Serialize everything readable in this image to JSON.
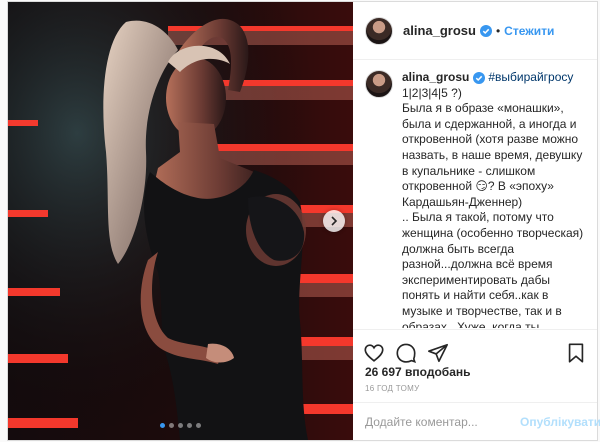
{
  "post": {
    "username": "alina_grosu",
    "follow_label": "Стежити",
    "separator": "•",
    "caption": {
      "username": "alina_grosu",
      "hashtag": "#выбирайгросу",
      "text": "1|2|3|4|5 ?)\nБыла я в образе «монашки», была и сдержанной, а иногда и откровенной (хотя разве можно назвать, в наше время, девушку в купальнике - слишком откровенной 😏? В «эпоху» Кардашьян-Дженнер)\n.. Была я такой, потому что женщина (особенно творческая) должна быть всегда разной...должна всё время экспериментировать дабы понять и найти себя..как в музыке и творчестве, так и в образах...Хуже, когда ты постоянно одинаковая, когда повергнуто все время оголяешься или прячешь своё тело от неприятия его... всё нужно в меру.. чтобы понять все свои грани, возможности и лучшие стороны."
    },
    "likes": "26 697 вподобань",
    "time_ago": "16 ГОД ТОМУ",
    "comment_placeholder": "Додайте коментар...",
    "publish_label": "Опублікувати",
    "carousel": {
      "count": 5,
      "active_index": 0
    },
    "colors": {
      "accent": "#3897f0",
      "verified": "#3897f0",
      "publish_disabled": "#b2dffc"
    },
    "icons": [
      "verified-icon",
      "heart-icon",
      "comment-icon",
      "share-icon",
      "bookmark-icon",
      "chevron-right-icon"
    ]
  }
}
